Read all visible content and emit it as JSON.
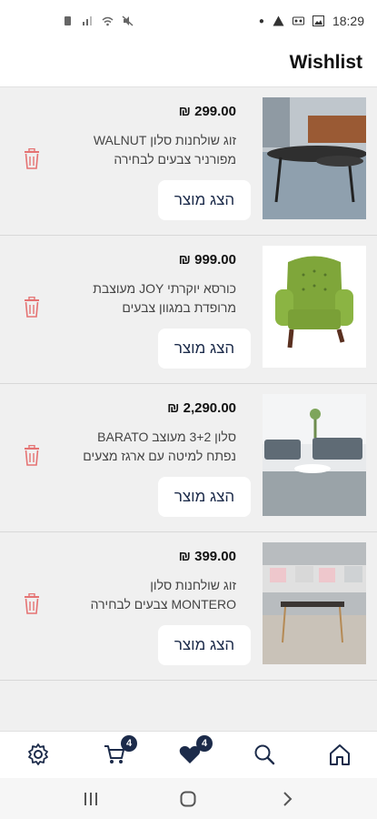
{
  "status_bar": {
    "time": "18:29"
  },
  "header": {
    "title": "Wishlist"
  },
  "items": [
    {
      "price": "299.00 ₪",
      "name": "זוג שולחנות סלון WALNUT מפורניר צבעים לבחירה",
      "button_label": "הצג מוצר",
      "image": "coffee-tables-photo"
    },
    {
      "price": "999.00 ₪",
      "name": "כורסא יוקרתי JOY מעוצבת מרופדת במגוון צבעים",
      "button_label": "הצג מוצר",
      "image": "green-armchair-photo"
    },
    {
      "price": "2,290.00 ₪",
      "name": "סלון 3+2 מעוצב BARATO נפתח למיטה עם ארגז מצעים",
      "button_label": "הצג מוצר",
      "image": "grey-sofa-set-photo"
    },
    {
      "price": "399.00 ₪",
      "name": "זוג שולחנות סלון MONTERO צבעים לבחירה",
      "button_label": "הצג מוצר",
      "image": "montero-tables-photo"
    }
  ],
  "bottom_nav": {
    "cart_count": "4",
    "wishlist_count": "4"
  },
  "colors": {
    "accent": "#1c2b4a",
    "trash": "#e57373",
    "background": "#f0f0f0"
  }
}
